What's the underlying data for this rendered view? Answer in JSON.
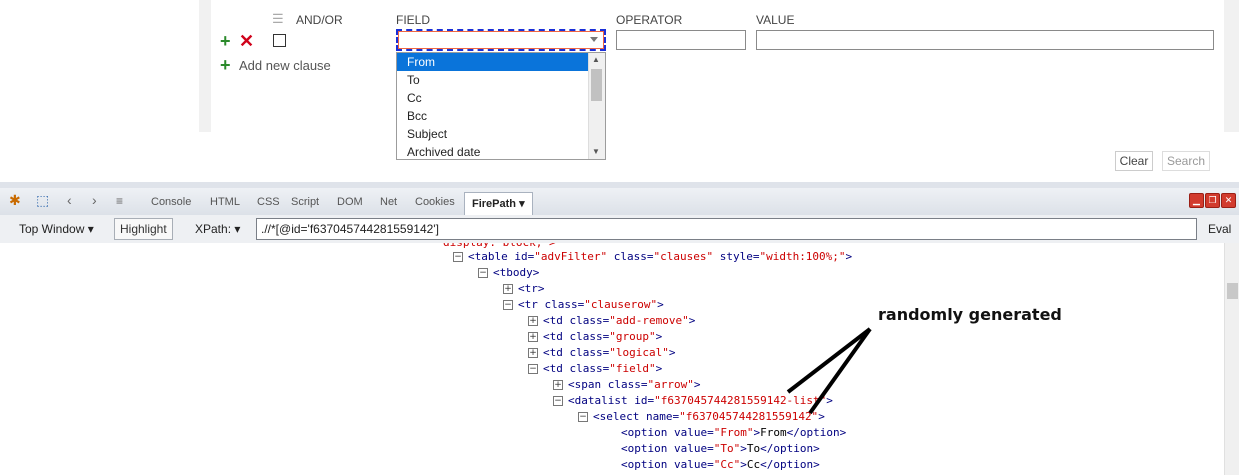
{
  "filter": {
    "headers": {
      "andor": "AND/OR",
      "field": "FIELD",
      "operator": "OPERATOR",
      "value": "VALUE"
    },
    "add_clause_label": "Add new clause",
    "field_options": [
      "From",
      "To",
      "Cc",
      "Bcc",
      "Subject",
      "Archived date"
    ],
    "selected_option": "From",
    "clear_label": "Clear",
    "search_label": "Search"
  },
  "firebug": {
    "tabs": [
      "Console",
      "HTML",
      "CSS",
      "Script",
      "DOM",
      "Net",
      "Cookies"
    ],
    "active_tab": "FirePath",
    "window_selector": "Top Window",
    "highlight_label": "Highlight",
    "xpath_label": "XPath:",
    "xpath_value": ".//*[@id='f637045744281559142']",
    "eval_label": "Eval"
  },
  "code": {
    "cut_line": "display: block;\">",
    "lines": [
      {
        "tag": "<table ",
        "attrs": [
          [
            "id",
            "advFilter"
          ],
          [
            "class",
            "clauses"
          ],
          [
            "style",
            "width:100%;"
          ]
        ],
        "end": ">"
      },
      {
        "tag": "<tbody",
        "attrs": [],
        "end": ">"
      },
      {
        "tag": "<tr",
        "attrs": [],
        "end": ">"
      },
      {
        "tag": "<tr ",
        "attrs": [
          [
            "class",
            "clauserow"
          ]
        ],
        "end": ">"
      },
      {
        "tag": "<td ",
        "attrs": [
          [
            "class",
            "add-remove"
          ]
        ],
        "end": ">"
      },
      {
        "tag": "<td ",
        "attrs": [
          [
            "class",
            "group"
          ]
        ],
        "end": ">"
      },
      {
        "tag": "<td ",
        "attrs": [
          [
            "class",
            "logical"
          ]
        ],
        "end": ">"
      },
      {
        "tag": "<td ",
        "attrs": [
          [
            "class",
            "field"
          ]
        ],
        "end": ">"
      },
      {
        "tag": "<span ",
        "attrs": [
          [
            "class",
            "arrow"
          ]
        ],
        "end": ">"
      },
      {
        "tag": "<datalist ",
        "attrs": [
          [
            "id",
            "f637045744281559142-list"
          ]
        ],
        "end": ">"
      },
      {
        "tag": "<select ",
        "attrs": [
          [
            "name",
            "f637045744281559142"
          ]
        ],
        "end": ">"
      },
      {
        "tag": "<option ",
        "attrs": [
          [
            "value",
            "From"
          ]
        ],
        "end": ">",
        "text": "From",
        "close": "</option>"
      },
      {
        "tag": "<option ",
        "attrs": [
          [
            "value",
            "To"
          ]
        ],
        "end": ">",
        "text": "To",
        "close": "</option>"
      },
      {
        "tag": "<option ",
        "attrs": [
          [
            "value",
            "Cc"
          ]
        ],
        "end": ">",
        "text": "Cc",
        "close": "</option>"
      }
    ]
  },
  "annotation": "randomly generated"
}
